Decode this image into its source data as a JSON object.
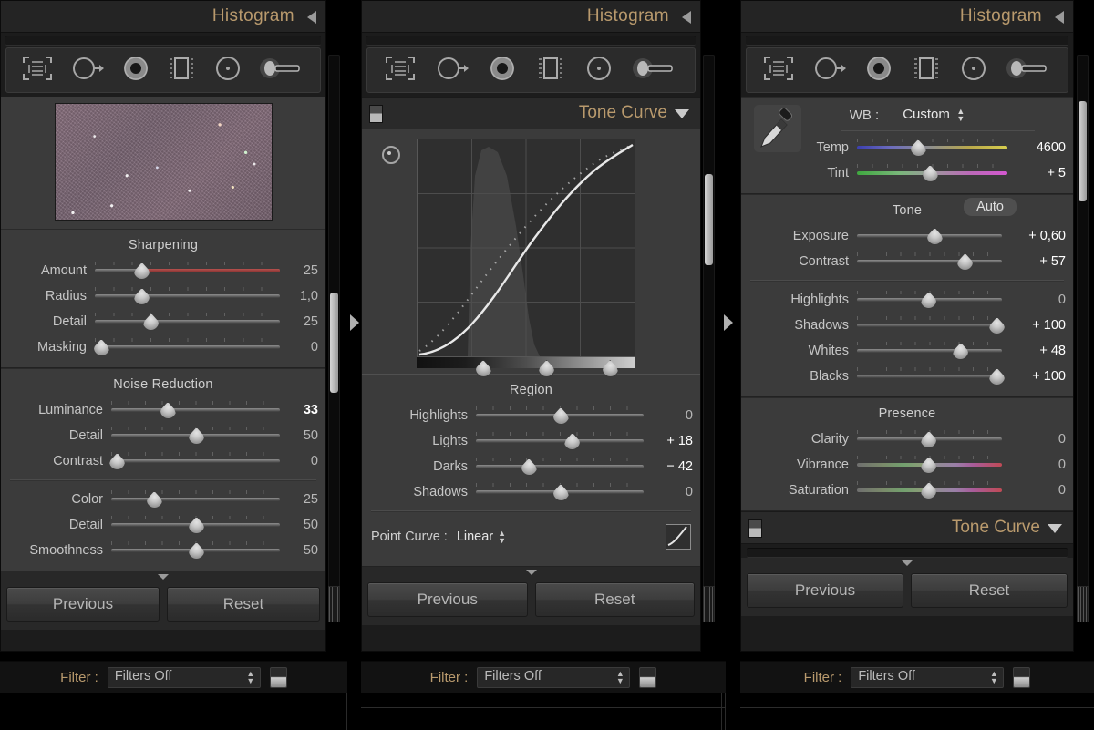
{
  "panels": [
    {
      "id": "left",
      "header": {
        "title": "Histogram",
        "collapse_icon": "triangle-left-icon"
      },
      "tools": [
        "crop-overlay-icon",
        "spot-removal-icon",
        "red-eye-icon",
        "graduated-filter-icon",
        "radial-filter-icon",
        "adjustment-brush-icon"
      ],
      "sections": [
        {
          "title": "Sharpening",
          "sliders": [
            {
              "label": "Amount",
              "value": "25",
              "pos": 25,
              "track": "plain-red"
            },
            {
              "label": "Radius",
              "value": "1,0",
              "pos": 25,
              "track": "plain"
            },
            {
              "label": "Detail",
              "value": "25",
              "pos": 30,
              "track": "plain"
            },
            {
              "label": "Masking",
              "value": "0",
              "pos": 3,
              "track": "plain"
            }
          ]
        },
        {
          "title": "Noise Reduction",
          "sliders": [
            {
              "label": "Luminance",
              "value": "33",
              "pos": 33,
              "track": "plain",
              "highlight": true
            },
            {
              "label": "Detail",
              "value": "50",
              "pos": 50,
              "track": "plain"
            },
            {
              "label": "Contrast",
              "value": "0",
              "pos": 3,
              "track": "plain"
            }
          ],
          "sliders2": [
            {
              "label": "Color",
              "value": "25",
              "pos": 25,
              "track": "plain"
            },
            {
              "label": "Detail",
              "value": "50",
              "pos": 50,
              "track": "plain"
            },
            {
              "label": "Smoothness",
              "value": "50",
              "pos": 50,
              "track": "plain"
            }
          ]
        }
      ],
      "buttons": {
        "previous": "Previous",
        "reset": "Reset"
      },
      "filter": {
        "label": "Filter :",
        "value": "Filters Off"
      }
    },
    {
      "id": "middle",
      "header": {
        "title": "Histogram",
        "collapse_icon": "triangle-left-icon"
      },
      "tone_curve": {
        "title": "Tone Curve",
        "region_title": "Region",
        "sliders": [
          {
            "label": "Highlights",
            "value": "0",
            "pos": 50
          },
          {
            "label": "Lights",
            "value": "+ 18",
            "pos": 57
          },
          {
            "label": "Darks",
            "value": "− 42",
            "pos": 31
          },
          {
            "label": "Shadows",
            "value": "0",
            "pos": 50
          }
        ],
        "point_curve_label": "Point Curve :",
        "point_curve_value": "Linear",
        "split_knobs": [
          30,
          69,
          107
        ]
      },
      "buttons": {
        "previous": "Previous",
        "reset": "Reset"
      },
      "filter": {
        "label": "Filter :",
        "value": "Filters Off"
      }
    },
    {
      "id": "right",
      "header": {
        "title": "Histogram",
        "collapse_icon": "triangle-left-icon"
      },
      "wb": {
        "label": "WB :",
        "value": "Custom",
        "sliders": [
          {
            "label": "Temp",
            "value": "4600",
            "pos": 40,
            "track": "temp",
            "bold": true
          },
          {
            "label": "Tint",
            "value": "+ 5",
            "pos": 48,
            "track": "tint",
            "bold": true
          }
        ]
      },
      "tone": {
        "title": "Tone",
        "auto_label": "Auto",
        "sliders": [
          {
            "label": "Exposure",
            "value": "+ 0,60",
            "pos": 53,
            "track": "plain",
            "bold": true
          },
          {
            "label": "Contrast",
            "value": "+ 57",
            "pos": 74,
            "track": "plain",
            "bold": true
          }
        ],
        "sliders2": [
          {
            "label": "Highlights",
            "value": "0",
            "pos": 49,
            "track": "plain"
          },
          {
            "label": "Shadows",
            "value": "+ 100",
            "pos": 96,
            "track": "plain",
            "bold": true
          },
          {
            "label": "Whites",
            "value": "+ 48",
            "pos": 71,
            "track": "plain",
            "bold": true
          },
          {
            "label": "Blacks",
            "value": "+ 100",
            "pos": 96,
            "track": "plain",
            "bold": true
          }
        ]
      },
      "presence": {
        "title": "Presence",
        "sliders": [
          {
            "label": "Clarity",
            "value": "0",
            "pos": 49,
            "track": "plain"
          },
          {
            "label": "Vibrance",
            "value": "0",
            "pos": 49,
            "track": "rainbow"
          },
          {
            "label": "Saturation",
            "value": "0",
            "pos": 49,
            "track": "rainbow"
          }
        ]
      },
      "tone_curve_header": "Tone Curve",
      "buttons": {
        "previous": "Previous",
        "reset": "Reset"
      },
      "filter": {
        "label": "Filter :",
        "value": "Filters Off"
      }
    }
  ],
  "colors": {
    "accent": "#b99a6d",
    "panel_bg": "#3b3b3b",
    "chrome_bg": "#1c1c1c",
    "slider_red": "#b8524f"
  }
}
